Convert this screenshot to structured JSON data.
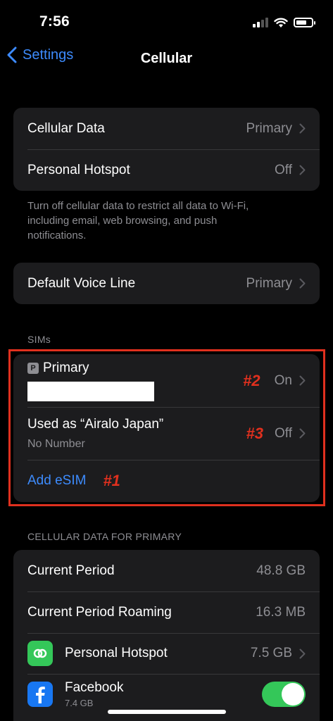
{
  "status_bar": {
    "time": "7:56"
  },
  "nav": {
    "back_label": "Settings",
    "title": "Cellular"
  },
  "group1": {
    "rows": [
      {
        "label": "Cellular Data",
        "value": "Primary"
      },
      {
        "label": "Personal Hotspot",
        "value": "Off"
      }
    ],
    "footer": "Turn off cellular data to restrict all data to Wi-Fi, including email, web browsing, and push notifications."
  },
  "group2": {
    "rows": [
      {
        "label": "Default Voice Line",
        "value": "Primary"
      }
    ]
  },
  "sims": {
    "header": "SIMs",
    "primary": {
      "badge": "P",
      "label": "Primary",
      "value": "On",
      "marker": "#2"
    },
    "secondary": {
      "label": "Used as “Airalo Japan”",
      "sub": "No Number",
      "value": "Off",
      "marker": "#3"
    },
    "add_esim": {
      "label": "Add eSIM",
      "marker": "#1"
    }
  },
  "usage": {
    "header": "CELLULAR DATA FOR PRIMARY",
    "rows": [
      {
        "label": "Current Period",
        "value": "48.8 GB"
      },
      {
        "label": "Current Period Roaming",
        "value": "16.3 MB"
      }
    ],
    "apps": [
      {
        "label": "Personal Hotspot",
        "value": "7.5 GB",
        "icon": "hotspot-icon"
      },
      {
        "label": "Facebook",
        "sub": "7.4 GB",
        "icon": "facebook-icon",
        "toggle_on": true
      }
    ]
  },
  "colors": {
    "accent": "#3d8bfd",
    "marker": "#e0301e",
    "toggle_on": "#34c759"
  }
}
